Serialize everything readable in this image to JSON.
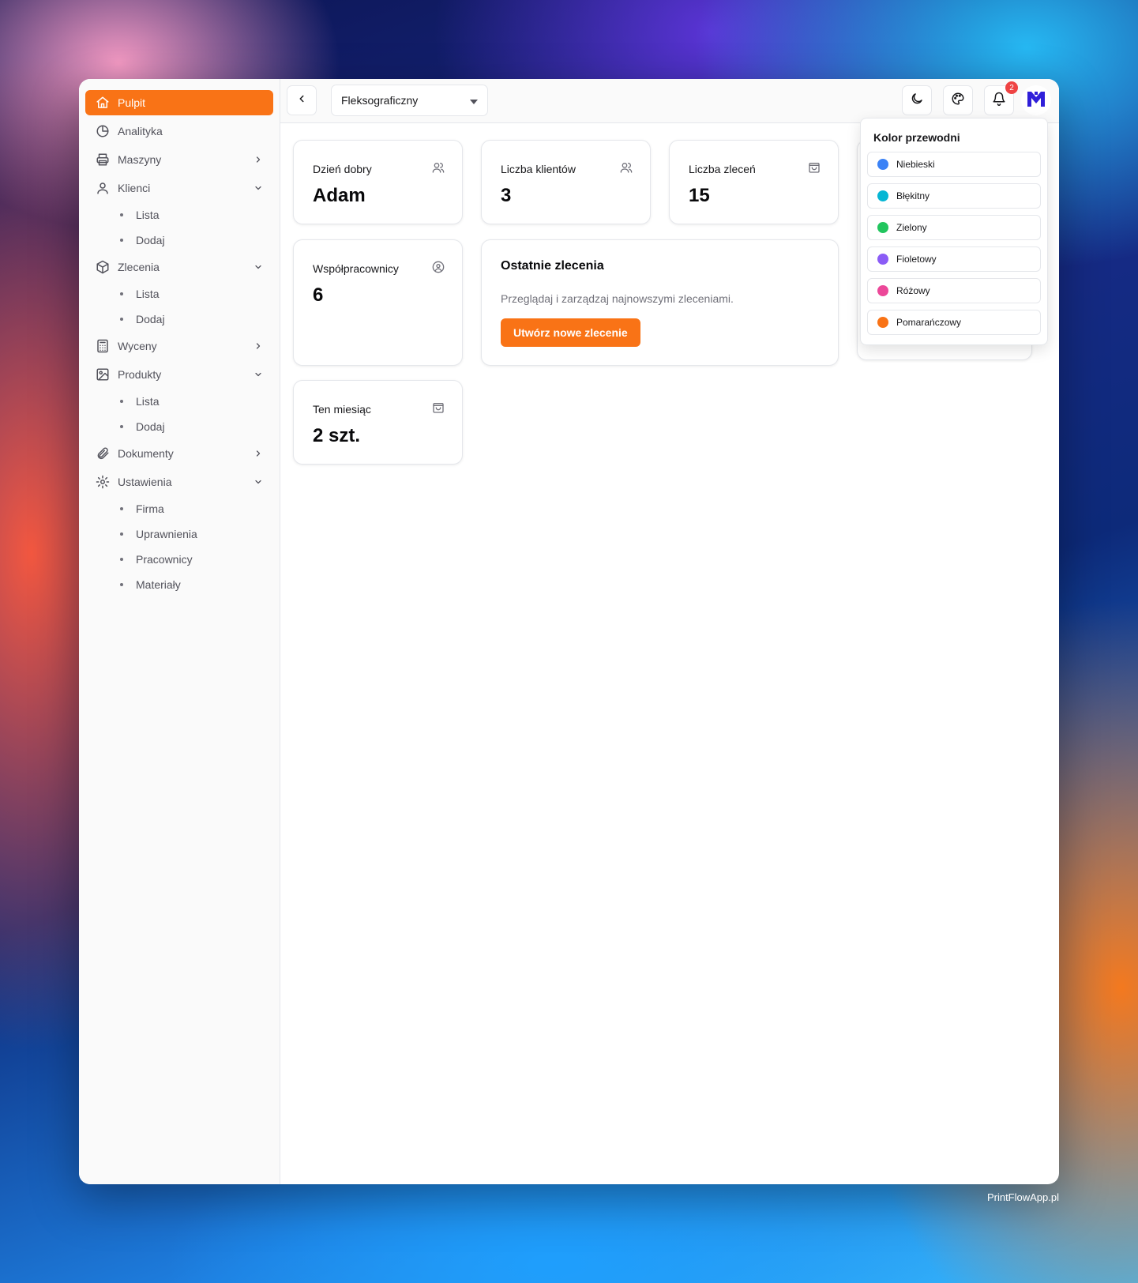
{
  "sidebar": {
    "items": [
      {
        "label": "Pulpit",
        "icon": "home-icon",
        "active": true
      },
      {
        "label": "Analityka",
        "icon": "chart-pie-icon"
      },
      {
        "label": "Maszyny",
        "icon": "printer-icon",
        "chevron": "right"
      },
      {
        "label": "Klienci",
        "icon": "user-icon",
        "chevron": "down",
        "children": [
          "Lista",
          "Dodaj"
        ]
      },
      {
        "label": "Zlecenia",
        "icon": "box-icon",
        "chevron": "down",
        "children": [
          "Lista",
          "Dodaj"
        ]
      },
      {
        "label": "Wyceny",
        "icon": "calculator-icon",
        "chevron": "right"
      },
      {
        "label": "Produkty",
        "icon": "image-icon",
        "chevron": "down",
        "children": [
          "Lista",
          "Dodaj"
        ]
      },
      {
        "label": "Dokumenty",
        "icon": "paperclip-icon",
        "chevron": "right"
      },
      {
        "label": "Ustawienia",
        "icon": "gear-icon",
        "chevron": "down",
        "children": [
          "Firma",
          "Uprawnienia",
          "Pracownicy",
          "Materiały"
        ]
      }
    ]
  },
  "topbar": {
    "select_value": "Fleksograficzny",
    "notification_count": "2"
  },
  "cards": {
    "greeting": {
      "title": "Dzień dobry",
      "value": "Adam"
    },
    "clients": {
      "title": "Liczba klientów",
      "value": "3"
    },
    "orders": {
      "title": "Liczba zleceń",
      "value": "15"
    },
    "coworkers": {
      "title": "Współpracownicy",
      "value": "6"
    },
    "month": {
      "title": "Ten miesiąc",
      "value": "2 szt."
    },
    "recent": {
      "title": "Ostatnie zlecenia",
      "description": "Przeglądaj i zarządzaj najnowszymi zleceniami.",
      "button": "Utwórz nowe zlecenie"
    }
  },
  "theme_popover": {
    "title": "Kolor przewodni",
    "options": [
      {
        "label": "Niebieski",
        "color": "#3b82f6"
      },
      {
        "label": "Błękitny",
        "color": "#06b6d4"
      },
      {
        "label": "Zielony",
        "color": "#22c55e"
      },
      {
        "label": "Fioletowy",
        "color": "#8b5cf6"
      },
      {
        "label": "Różowy",
        "color": "#ec4899"
      },
      {
        "label": "Pomarańczowy",
        "color": "#f97316"
      }
    ]
  },
  "footer": {
    "text": "PrintFlowApp.pl"
  },
  "colors": {
    "accent": "#f97316",
    "badge": "#ef4444"
  }
}
